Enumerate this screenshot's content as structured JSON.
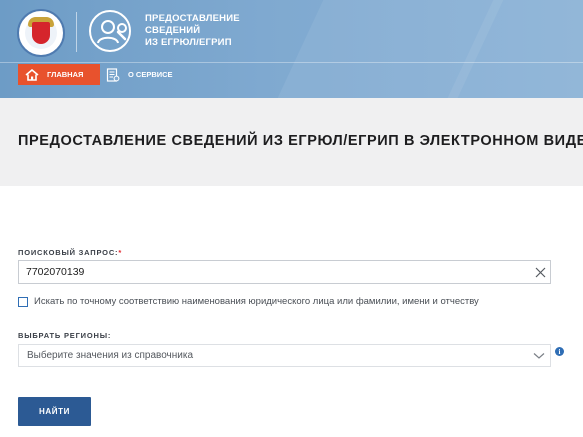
{
  "header": {
    "title_lines": [
      "ПРЕДОСТАВЛЕНИЕ",
      "СВЕДЕНИЙ",
      "ИЗ ЕГРЮЛ/ЕГРИП"
    ],
    "logo_icon": "fns-emblem-icon",
    "service_icon": "user-wrench-icon",
    "background_color": "#7fa9d0"
  },
  "nav": {
    "home_label": "ГЛАВНАЯ",
    "home_icon": "home-icon",
    "about_label": "О СЕРВИСЕ",
    "about_icon": "document-icon",
    "active_color": "#e8522d"
  },
  "page": {
    "title": "ПРЕДОСТАВЛЕНИЕ СВЕДЕНИЙ ИЗ ЕГРЮЛ/ЕГРИП В ЭЛЕКТРОННОМ ВИДЕ"
  },
  "form": {
    "search_label": "ПОИСКОВЫЙ ЗАПРОС:",
    "required_mark": "*",
    "search_value": "7702070139",
    "clear_icon": "close-icon",
    "exact_match_label": "Искать по точному соответствию наименования юридического лица или фамилии, имени и отчеству",
    "exact_match_checked": false,
    "regions_label": "ВЫБРАТЬ РЕГИОНЫ:",
    "regions_placeholder": "Выберите значения из справочника",
    "info_icon_text": "i",
    "submit_label": "НАЙТИ",
    "submit_color": "#2c5a94"
  }
}
